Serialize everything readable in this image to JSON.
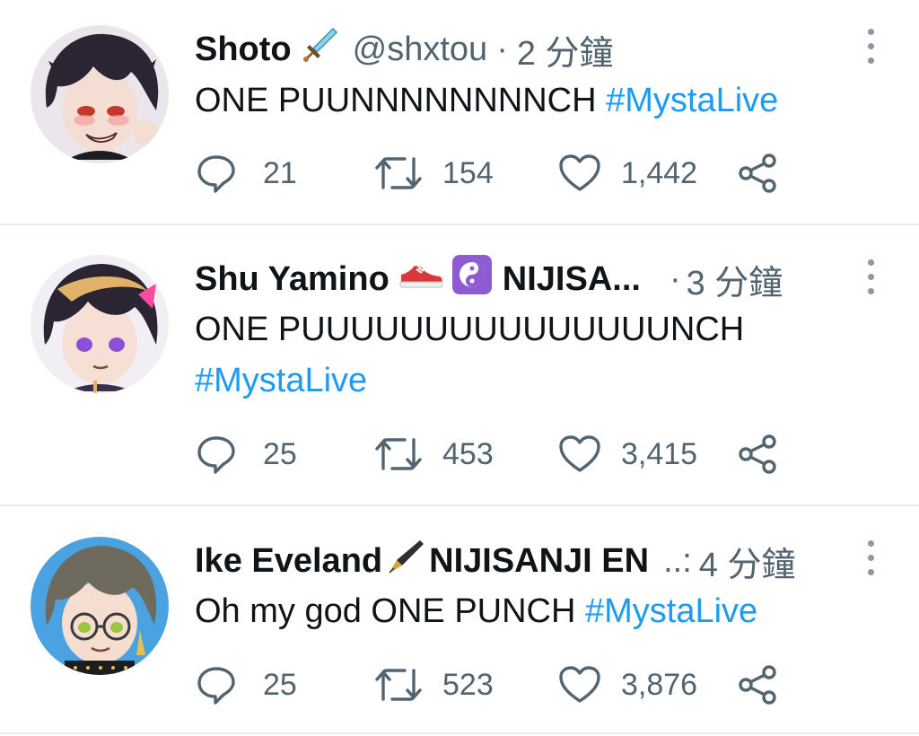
{
  "tweets": [
    {
      "name": "Shoto",
      "name_emoji": "dagger-icon",
      "handle": "@shxtou",
      "separator": "·",
      "time": "2 分鐘",
      "text": "ONE PUUNNNNNNNNCH ",
      "hashtag": "#MystaLive",
      "replies": "21",
      "retweets": "154",
      "likes": "1,442"
    },
    {
      "name": "Shu Yamino",
      "name_emoji": "sneaker-icon",
      "name_emoji_2": "yin-yang-icon",
      "name_suffix": "NIJISA...",
      "separator": "·",
      "time": "3 分鐘",
      "text": "ONE PUUUUUUUUUUUUUUUNCH",
      "hashtag": "#MystaLive",
      "replies": "25",
      "retweets": "453",
      "likes": "3,415"
    },
    {
      "name": "Ike Eveland",
      "name_emoji": "fountain-pen-icon",
      "name_suffix": "NIJISANJI EN",
      "ellipsis": "..:",
      "time": "4 分鐘",
      "text": "Oh my god ONE PUNCH ",
      "hashtag": "#MystaLive",
      "replies": "25",
      "retweets": "523",
      "likes": "3,876"
    }
  ],
  "colors": {
    "text": "#0f1419",
    "secondary": "#536471",
    "hashtag": "#1d9bf0",
    "divider": "#e7ecf0"
  }
}
